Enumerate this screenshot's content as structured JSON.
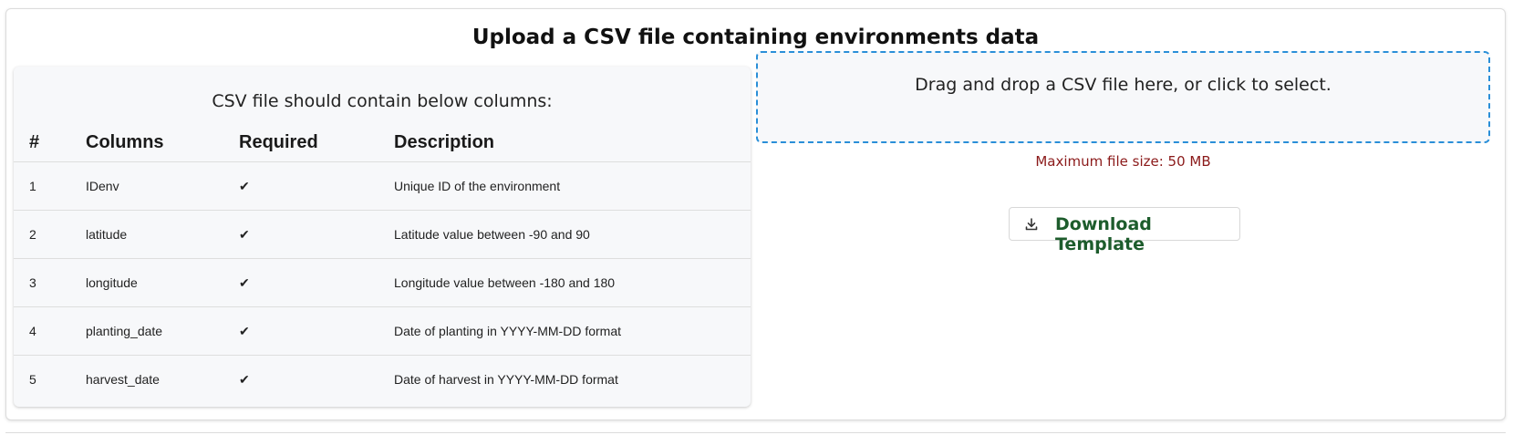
{
  "page": {
    "title": "Upload a CSV file containing environments data"
  },
  "columns_table": {
    "caption": "CSV file should contain below columns:",
    "headers": [
      "#",
      "Columns",
      "Required",
      "Description"
    ],
    "rows": [
      {
        "num": "1",
        "column": "IDenv",
        "required": "✔",
        "description": "Unique ID of the environment"
      },
      {
        "num": "2",
        "column": "latitude",
        "required": "✔",
        "description": "Latitude value between -90 and 90"
      },
      {
        "num": "3",
        "column": "longitude",
        "required": "✔",
        "description": "Longitude value between -180 and 180"
      },
      {
        "num": "4",
        "column": "planting_date",
        "required": "✔",
        "description": "Date of planting in YYYY-MM-DD format"
      },
      {
        "num": "5",
        "column": "harvest_date",
        "required": "✔",
        "description": "Date of harvest in YYYY-MM-DD format"
      }
    ]
  },
  "upload": {
    "dropzone_text": "Drag and drop a CSV file here, or click to select.",
    "max_size_text": "Maximum file size: 50 MB",
    "download_label": "Download Template",
    "download_icon": "download-icon"
  },
  "colors": {
    "dropzone_border": "#2a8fd8",
    "max_size_text": "#8b1a1a",
    "download_label": "#1d5c2c"
  }
}
